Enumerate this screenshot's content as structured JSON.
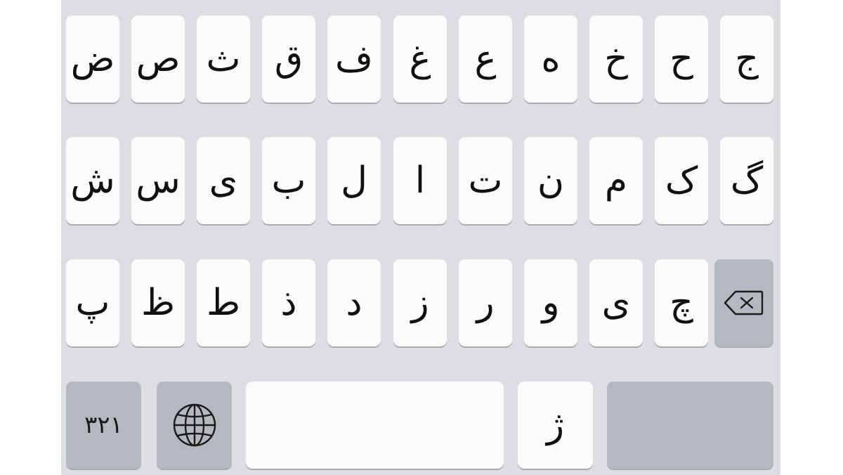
{
  "keyboard": {
    "row1": [
      "ج",
      "ح",
      "خ",
      "ه",
      "ع",
      "غ",
      "ف",
      "ق",
      "ث",
      "ص",
      "ض"
    ],
    "row2": [
      "گ",
      "ک",
      "م",
      "ن",
      "ت",
      "ا",
      "ل",
      "ب",
      "ی",
      "س",
      "ش"
    ],
    "row3": [
      "چ",
      "ی",
      "و",
      "ر",
      "ز",
      "د",
      "ذ",
      "ط",
      "ظ",
      "پ"
    ],
    "bottom": {
      "numbers_label": "۳۲۱",
      "globe_icon": "globe-icon",
      "space_label": "",
      "extra_letter": "ژ",
      "return_label": ""
    },
    "backspace_icon": "backspace-icon",
    "colors": {
      "background": "#dddee2",
      "letter_key": "#fbfbfc",
      "function_key": "#b5b8bf"
    }
  }
}
